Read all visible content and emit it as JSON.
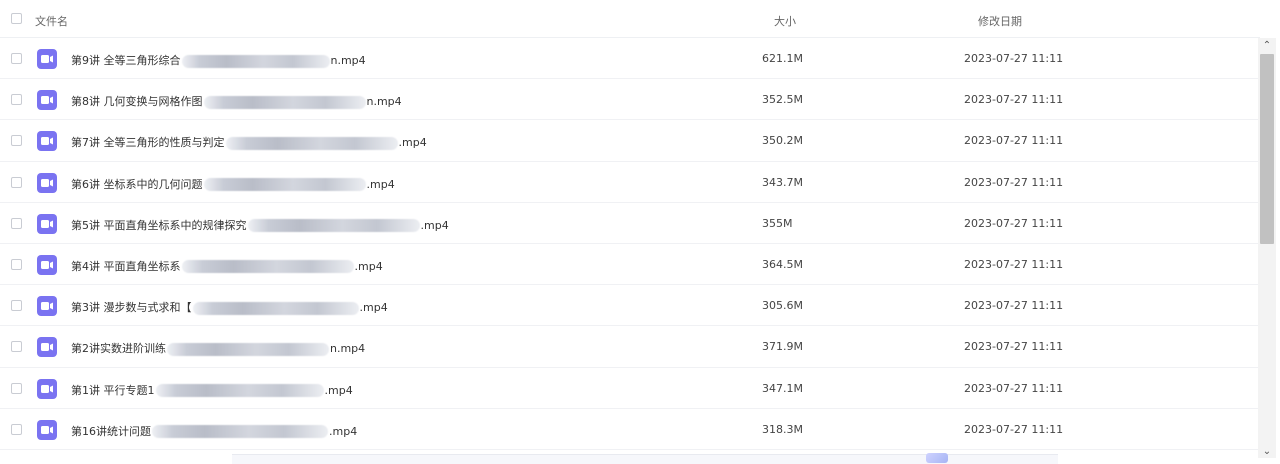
{
  "header": {
    "name_label": "文件名",
    "size_label": "大小",
    "date_label": "修改日期"
  },
  "files": [
    {
      "prefix": "第9讲 全等三角形综合",
      "suffix": "n.mp4",
      "size": "621.1M",
      "date": "2023-07-27 11:11"
    },
    {
      "prefix": "第8讲 几何变换与网格作图",
      "suffix": "n.mp4",
      "size": "352.5M",
      "date": "2023-07-27 11:11"
    },
    {
      "prefix": "第7讲 全等三角形的性质与判定",
      "suffix": ".mp4",
      "size": "350.2M",
      "date": "2023-07-27 11:11"
    },
    {
      "prefix": "第6讲 坐标系中的几何问题",
      "suffix": ".mp4",
      "size": "343.7M",
      "date": "2023-07-27 11:11"
    },
    {
      "prefix": "第5讲 平面直角坐标系中的规律探究",
      "suffix": ".mp4",
      "size": "355M",
      "date": "2023-07-27 11:11"
    },
    {
      "prefix": "第4讲 平面直角坐标系",
      "suffix": ".mp4",
      "size": "364.5M",
      "date": "2023-07-27 11:11"
    },
    {
      "prefix": "第3讲 漫步数与式求和【",
      "suffix": ".mp4",
      "size": "305.6M",
      "date": "2023-07-27 11:11"
    },
    {
      "prefix": "第2讲实数进阶训练",
      "suffix": "n.mp4",
      "size": "371.9M",
      "date": "2023-07-27 11:11"
    },
    {
      "prefix": "第1讲 平行专题1",
      "suffix": ".mp4",
      "size": "347.1M",
      "date": "2023-07-27 11:11"
    },
    {
      "prefix": "第16讲统计问题",
      "suffix": ".mp4",
      "size": "318.3M",
      "date": "2023-07-27 11:11"
    }
  ],
  "scrollbar": {
    "up_glyph": "⌃",
    "down_glyph": "⌄"
  },
  "icons": {
    "file": "video-file-icon",
    "accent": "#7a73f1"
  }
}
